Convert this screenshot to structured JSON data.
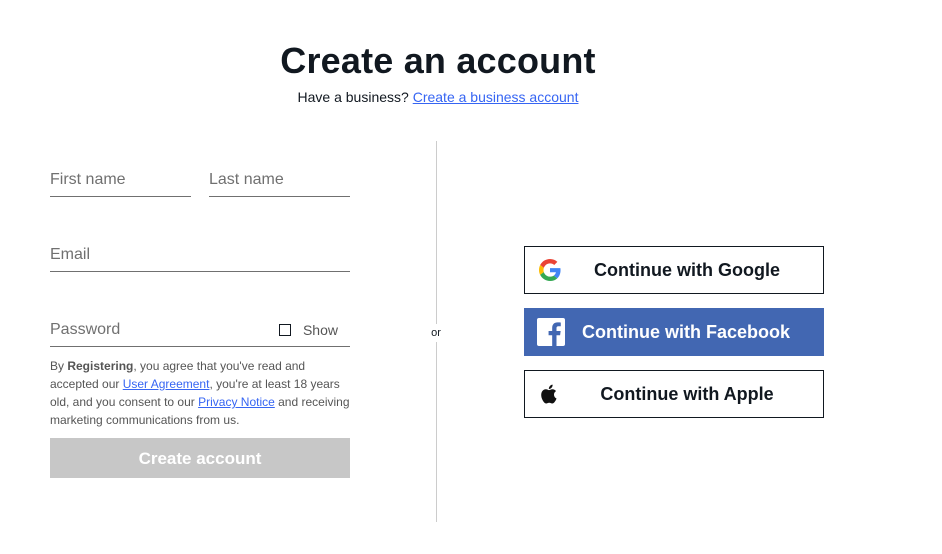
{
  "header": {
    "title": "Create an account",
    "business_prompt": "Have a business?",
    "business_link": "Create a business account"
  },
  "form": {
    "first_name_placeholder": "First name",
    "last_name_placeholder": "Last name",
    "email_placeholder": "Email",
    "password_placeholder": "Password",
    "show_label": "Show",
    "legal": {
      "part1": "By ",
      "registering": "Registering",
      "part2": ", you agree that you've read and accepted our ",
      "user_agreement": "User Agreement",
      "part3": ", you're at least 18 years old, and you consent to our ",
      "privacy_notice": "Privacy Notice",
      "part4": " and receiving marketing communications from us."
    },
    "submit_label": "Create account"
  },
  "divider": {
    "or_label": "or"
  },
  "social": {
    "google_label": "Continue with Google",
    "facebook_label": "Continue with Facebook",
    "apple_label": "Continue with Apple"
  },
  "colors": {
    "link": "#3665f3",
    "facebook": "#4267b2",
    "submit_disabled": "#c7c7c7",
    "text": "#111820"
  },
  "icons": [
    "google-icon",
    "facebook-icon",
    "apple-icon",
    "checkbox-icon"
  ]
}
